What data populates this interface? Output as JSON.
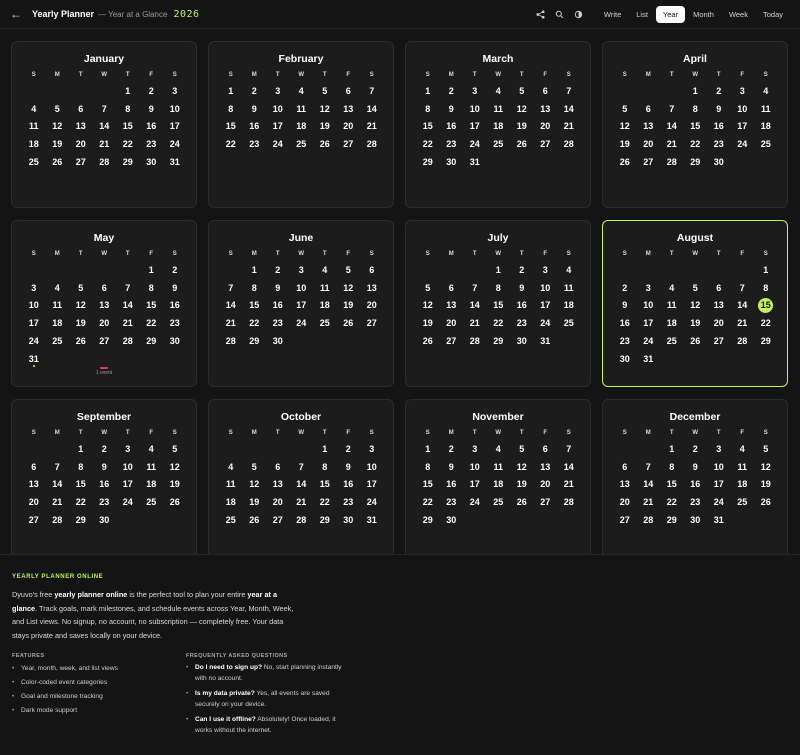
{
  "header": {
    "title": "Yearly Planner",
    "subtitle": "— Year at a Glance",
    "year": "2026",
    "nav": [
      "Write",
      "List",
      "Year",
      "Month",
      "Week",
      "Today"
    ],
    "active_nav": "Year",
    "icons": [
      "back-arrow-icon",
      "share-icon",
      "search-icon",
      "theme-toggle-icon"
    ]
  },
  "calendar": {
    "weekday_labels": [
      "S",
      "M",
      "T",
      "W",
      "T",
      "F",
      "S"
    ],
    "today": {
      "month": "August",
      "day": 15
    },
    "months": [
      {
        "name": "January",
        "offset": 4,
        "days": 31
      },
      {
        "name": "February",
        "offset": 0,
        "days": 28
      },
      {
        "name": "March",
        "offset": 0,
        "days": 31
      },
      {
        "name": "April",
        "offset": 3,
        "days": 30
      },
      {
        "name": "May",
        "offset": 5,
        "days": 31,
        "event_day": 31,
        "event_text": "1 event"
      },
      {
        "name": "June",
        "offset": 1,
        "days": 30
      },
      {
        "name": "July",
        "offset": 3,
        "days": 31
      },
      {
        "name": "August",
        "offset": 6,
        "days": 31
      },
      {
        "name": "September",
        "offset": 2,
        "days": 30
      },
      {
        "name": "October",
        "offset": 4,
        "days": 31
      },
      {
        "name": "November",
        "offset": 0,
        "days": 30
      },
      {
        "name": "December",
        "offset": 2,
        "days": 31
      }
    ]
  },
  "footer": {
    "section_title": "YEARLY PLANNER ONLINE",
    "intro": {
      "p1": "Dyuvo's free ",
      "b1": "yearly planner online",
      "p2": " is the perfect tool to plan your entire ",
      "b2": "year at a glance",
      "p3": ". Track goals, mark milestones, and schedule events across Year, Month, Week, and List views. No signup, no account, no subscription — completely free. Your data stays private and saves locally on your device."
    },
    "features_title": "FEATURES",
    "features": [
      "Year, month, week, and list views",
      "Color-coded event categories",
      "Goal and milestone tracking",
      "Dark mode support"
    ],
    "faq_title": "FREQUENTLY ASKED QUESTIONS",
    "faq": [
      {
        "q": "Do I need to sign up?",
        "a": " No, start planning instantly with no account."
      },
      {
        "q": "Is my data private?",
        "a": " Yes, all events are saved securely on your device."
      },
      {
        "q": "Can I use it offline?",
        "a": " Absolutely! Once loaded, it works without the internet."
      }
    ]
  }
}
